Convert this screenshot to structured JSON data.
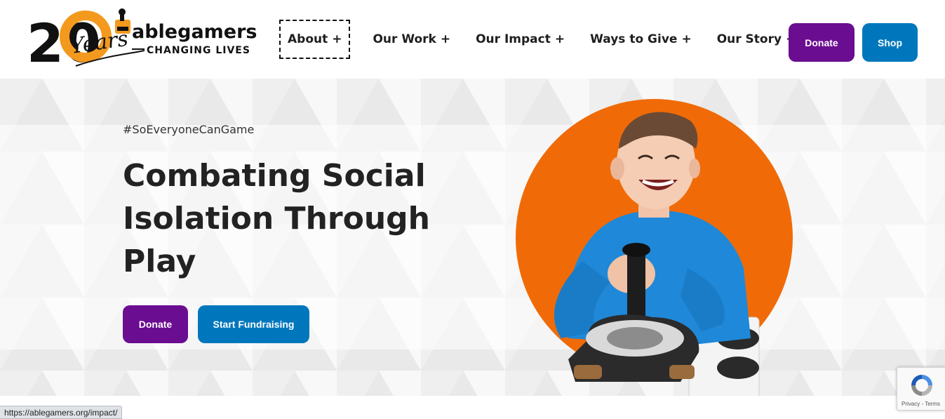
{
  "brand": {
    "years_number": "20",
    "years_word": "Years",
    "name": "ablegamers",
    "tagline": "CHANGING LIVES",
    "colors": {
      "orange": "#f39a1e",
      "purple": "#6a0d91",
      "blue": "#0077bd",
      "hero_circle": "#f06b08"
    }
  },
  "nav": {
    "items": [
      {
        "label": "About",
        "suffix": "+",
        "focused": true
      },
      {
        "label": "Our Work",
        "suffix": "+"
      },
      {
        "label": "Our Impact",
        "suffix": "+"
      },
      {
        "label": "Ways to Give",
        "suffix": "+"
      },
      {
        "label": "Our Story",
        "suffix": "+"
      }
    ]
  },
  "header_buttons": {
    "donate_label": "Donate",
    "shop_label": "Shop"
  },
  "hero": {
    "hashtag": "#SoEveryoneCanGame",
    "headline_lines": [
      "Combating Social",
      "Isolation Through",
      "Play"
    ],
    "donate_label": "Donate",
    "fundraise_label": "Start Fundraising",
    "image_alt_icon": "person-with-adaptive-joystick-image"
  },
  "status_bar": {
    "url": "https://ablegamers.org/impact/"
  },
  "recaptcha": {
    "label": "Privacy - Terms"
  }
}
